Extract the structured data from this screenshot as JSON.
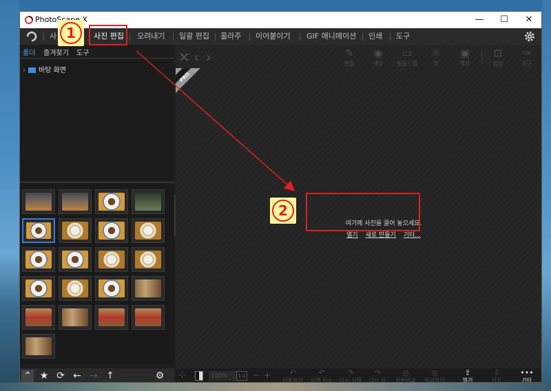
{
  "window": {
    "title": "PhotoScape X",
    "minimize": "—",
    "maximize": "☐",
    "close": "✕"
  },
  "menu": [
    {
      "label": "사진 편집",
      "active": true
    },
    {
      "label": "오려내기"
    },
    {
      "label": "일괄 편집"
    },
    {
      "label": "콜라주"
    },
    {
      "label": "이어붙이기"
    },
    {
      "label": "GIF 애니메이션"
    },
    {
      "label": "인쇄"
    },
    {
      "label": "도구"
    }
  ],
  "menu_partial_first": "사",
  "left_panel": {
    "tabs": [
      "폴더",
      "즐겨찾기",
      "도구"
    ],
    "tree_item": "바탕 화면"
  },
  "toolbar": {
    "tools": [
      {
        "label": "편집",
        "icon": "edit-icon"
      },
      {
        "label": "색상",
        "icon": "color-icon"
      },
      {
        "label": "필름느낌",
        "icon": "film-icon"
      },
      {
        "label": "빛",
        "icon": "light-icon"
      },
      {
        "label": "액자",
        "icon": "frame-icon"
      },
      {
        "label": "삽입",
        "icon": "insert-icon"
      },
      {
        "label": "도구",
        "icon": "tools-icon"
      }
    ]
  },
  "pro_badge": "PRO",
  "drop_zone": {
    "message": "여기에 사진을 끌어 놓으세요.",
    "links": [
      "열기",
      "새로 만들기",
      "기타..."
    ]
  },
  "footer": {
    "zoom_value": "100%",
    "zoom_btn": "1:1",
    "minus": "−",
    "plus": "+",
    "actions": [
      {
        "label": "되돌리기",
        "icon": "↶"
      },
      {
        "label": "실행 취소",
        "icon": "↶"
      },
      {
        "label": "다시 실행",
        "icon": "↷"
      },
      {
        "label": "다시 실",
        "icon": "↷"
      },
      {
        "label": "원본비교",
        "icon": "◎"
      },
      {
        "label": "비교하기",
        "icon": "◎"
      },
      {
        "label": "열기",
        "icon": "⇪",
        "bright": true
      },
      {
        "label": "저장",
        "icon": "⇩"
      },
      {
        "label": "기타",
        "icon": "•••",
        "bright": true
      }
    ]
  },
  "annotations": {
    "step1": "1",
    "step2": "2"
  },
  "colors": {
    "accent": "#3a79d8",
    "highlight": "#e02020",
    "step_bg": "#fff6a0"
  }
}
